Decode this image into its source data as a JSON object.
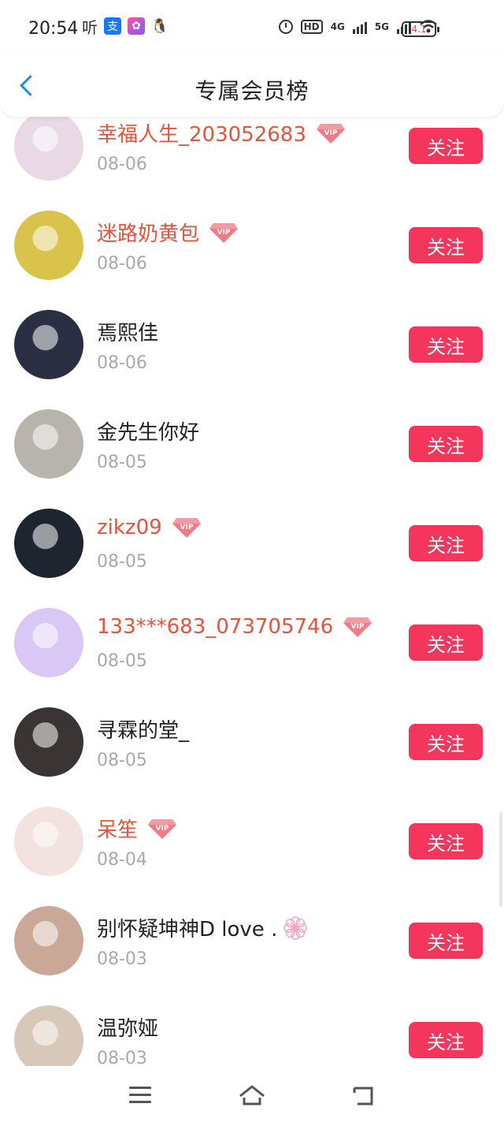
{
  "status_bar": {
    "time": "20:54",
    "ting": "听",
    "network_labels": [
      "HD",
      "4G",
      "5G"
    ],
    "battery_label": "4.1"
  },
  "header": {
    "title": "专属会员榜",
    "back_icon": "chevron-left-icon"
  },
  "follow_label": "关注",
  "members": [
    {
      "name": "幸福人生_203052683",
      "date": "08-06",
      "vip": true,
      "avatar_color": "#e9d9e6"
    },
    {
      "name": "迷路奶黄包",
      "date": "08-06",
      "vip": true,
      "avatar_color": "#d9c34a"
    },
    {
      "name": "焉熙佳",
      "date": "08-06",
      "vip": false,
      "avatar_color": "#2a2f44"
    },
    {
      "name": "金先生你好",
      "date": "08-05",
      "vip": false,
      "avatar_color": "#b8b4ad"
    },
    {
      "name": "zikz09",
      "date": "08-05",
      "vip": true,
      "avatar_color": "#1e2430"
    },
    {
      "name": "133***683_073705746",
      "date": "08-05",
      "vip": true,
      "avatar_color": "#d9c7f5"
    },
    {
      "name": "寻霖的堂_",
      "date": "08-05",
      "vip": false,
      "avatar_color": "#3a3434"
    },
    {
      "name": "呆笙",
      "date": "08-04",
      "vip": true,
      "avatar_color": "#f3e3e0"
    },
    {
      "name": "别怀疑坤神D love .",
      "date": "08-03",
      "vip": false,
      "avatar_color": "#c9a898"
    },
    {
      "name": "温弥娅",
      "date": "08-03",
      "vip": false,
      "avatar_color": "#d8c8b9"
    }
  ],
  "colors": {
    "vip_name": "#e5543d",
    "follow_button": "#f5365c",
    "accent_back": "#1f8fe8",
    "date_text": "#a9a9a9"
  }
}
